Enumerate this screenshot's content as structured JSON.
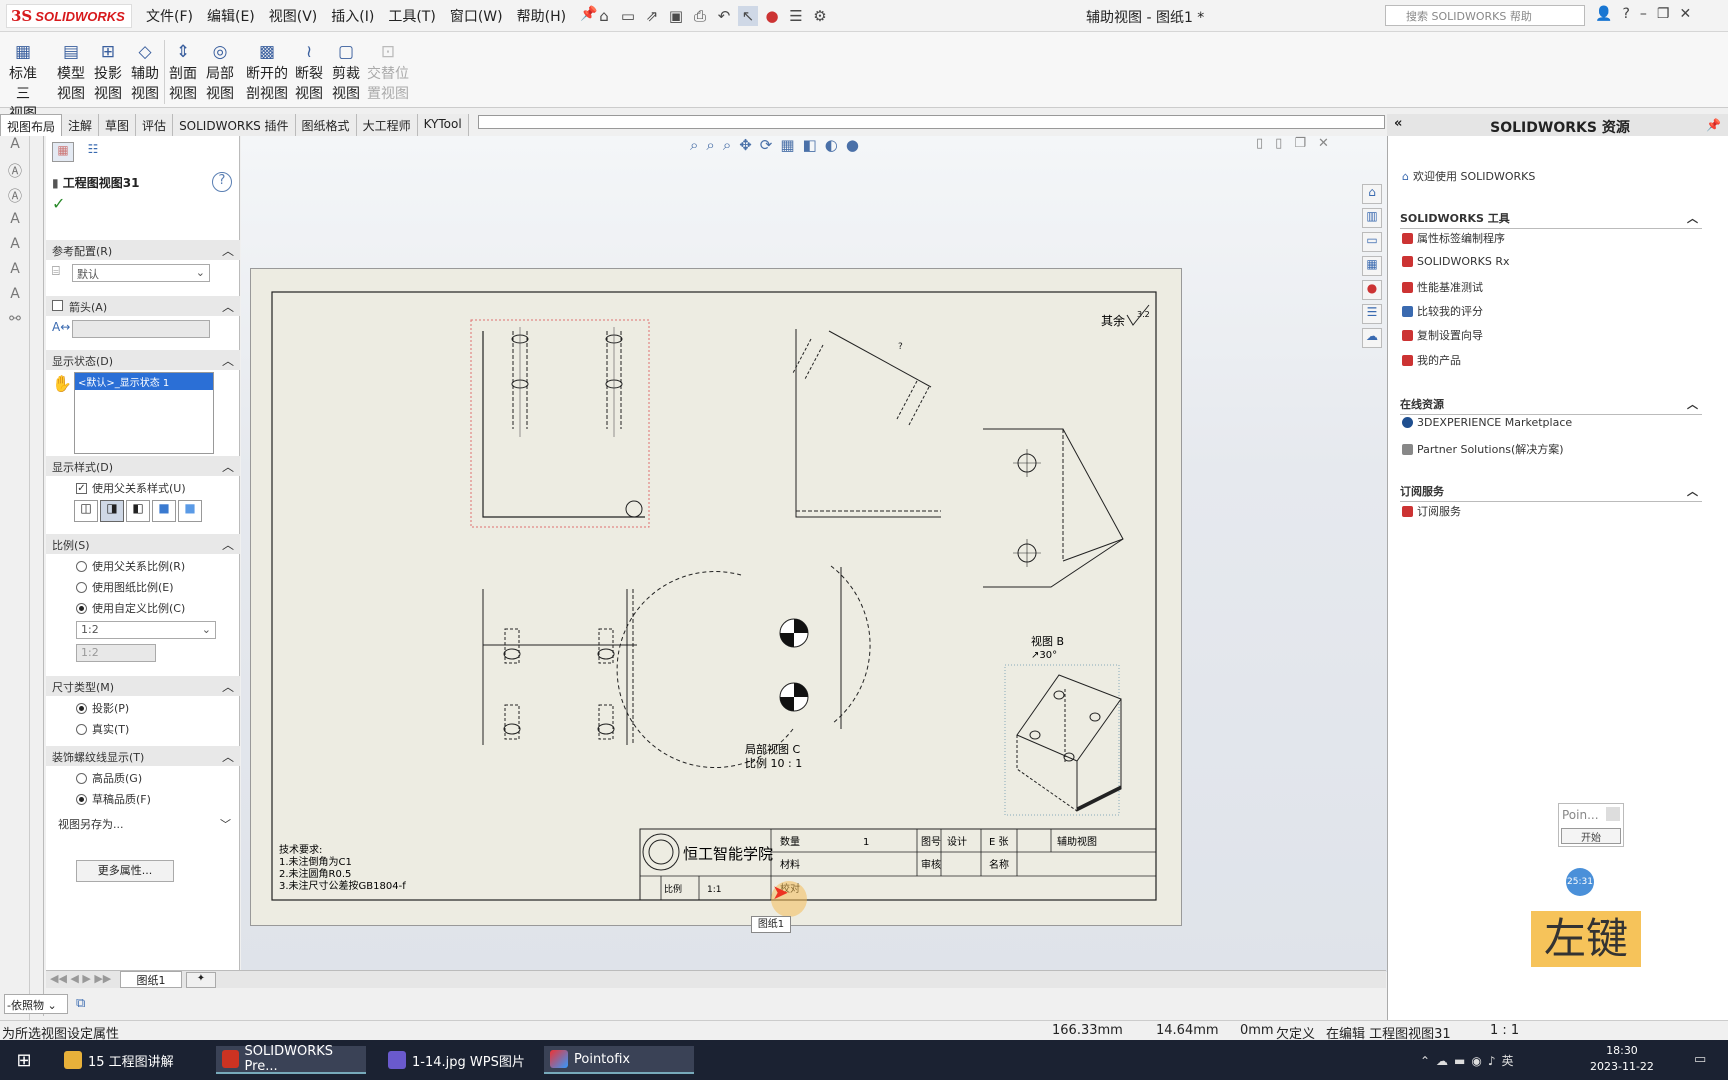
{
  "titlebar": {
    "brand": "SOLIDWORKS",
    "menus": [
      "文件(F)",
      "编辑(E)",
      "视图(V)",
      "插入(I)",
      "工具(T)",
      "窗口(W)",
      "帮助(H)"
    ],
    "doc_title": "辅助视图 - 图纸1 *",
    "search_placeholder": "搜索 SOLIDWORKS 帮助"
  },
  "ribbon": {
    "buttons": [
      {
        "l1": "标准三",
        "l2": "视图",
        "enabled": true
      },
      {
        "l1": "模型",
        "l2": "视图",
        "enabled": true
      },
      {
        "l1": "投影",
        "l2": "视图",
        "enabled": true
      },
      {
        "l1": "辅助",
        "l2": "视图",
        "enabled": true
      },
      {
        "l1": "剖面",
        "l2": "视图",
        "enabled": true
      },
      {
        "l1": "局部",
        "l2": "视图",
        "enabled": true
      },
      {
        "l1": "断开的",
        "l2": "剖视图",
        "enabled": true
      },
      {
        "l1": "断裂",
        "l2": "视图",
        "enabled": true
      },
      {
        "l1": "剪裁",
        "l2": "视图",
        "enabled": true
      },
      {
        "l1": "交替位",
        "l2": "置视图",
        "enabled": false
      }
    ],
    "tabs": [
      "视图布局",
      "注解",
      "草图",
      "评估",
      "SOLIDWORKS 插件",
      "图纸格式",
      "大工程师",
      "KYTool"
    ]
  },
  "property_manager": {
    "title": "工程图视图31",
    "sections": {
      "ref_config": "参考配置(R)",
      "ref_config_value": "默认",
      "arrow": "箭头(A)",
      "display_state": "显示状态(D)",
      "display_state_value": "<默认>_显示状态 1",
      "display_style": "显示样式(D)",
      "use_parent_style": "使用父关系样式(U)",
      "scale": "比例(S)",
      "scale_options": [
        "使用父关系比例(R)",
        "使用图纸比例(E)",
        "使用自定义比例(C)"
      ],
      "scale_value": "1:2",
      "scale_custom": "1:2",
      "dim_type": "尺寸类型(M)",
      "dim_options": [
        "投影(P)",
        "真实(T)"
      ],
      "thread": "装饰螺纹线显示(T)",
      "thread_options": [
        "高品质(G)",
        "草稿品质(F)"
      ],
      "save_as": "视图另存为...",
      "more_props": "更多属性..."
    }
  },
  "drawing": {
    "roughness_note": "其余",
    "roughness_value": "3.2",
    "view_b_label": "视图 B",
    "view_b_angle": "↗30°",
    "section_c_label": "局部视图 C",
    "section_c_scale": "比例 10 : 1",
    "notes_title": "技术要求:",
    "notes": [
      "1.未注倒角为C1",
      "2.未注圆角R0.5",
      "3.未注尺寸公差按GB1804-f"
    ],
    "school": "恒工智能学院",
    "tb_qty_label": "数量",
    "tb_qty_value": "1",
    "tb_material_label": "材料",
    "tb_scale_label": "比例",
    "tb_scale_value": "1:1",
    "tb_drawing_label": "图号",
    "tb_designer_label": "设计",
    "tb_approve_label": "审核",
    "tb_checker_label": "校对",
    "tb_name_label": "名称",
    "tb_name_value": "辅助视图",
    "tb_sheet_label": "E 张",
    "sheet_tooltip": "图纸1"
  },
  "task_pane": {
    "title": "SOLIDWORKS 资源",
    "welcome": "欢迎使用 SOLIDWORKS",
    "tools_header": "SOLIDWORKS 工具",
    "tools": [
      "属性标签编制程序",
      "SOLIDWORKS Rx",
      "性能基准测试",
      "比较我的评分",
      "复制设置向导",
      "我的产品"
    ],
    "online_header": "在线资源",
    "online": [
      "3DEXPERIENCE Marketplace",
      "Partner Solutions(解决方案)"
    ],
    "sub_header": "订阅服务",
    "sub": [
      "订阅服务"
    ]
  },
  "overlays": {
    "point_title": "Poin...",
    "point_btn": "开始",
    "timer": "25:31",
    "key_label": "左键"
  },
  "bottom": {
    "sheet_tab": "图纸1",
    "combo": "-依照物",
    "status_left": "为所选视图设定属性",
    "coord_x": "166.33mm",
    "coord_y": "14.64mm",
    "coord_z": "0mm",
    "status_def": "欠定义",
    "status_edit": "在编辑 工程图视图31",
    "status_scale": "1 : 1"
  },
  "taskbar": {
    "items": [
      "15 工程图讲解",
      "SOLIDWORKS Pre...",
      "1-14.jpg  WPS图片",
      "Pointofix"
    ],
    "time": "18:30",
    "date": "2023-11-22"
  }
}
